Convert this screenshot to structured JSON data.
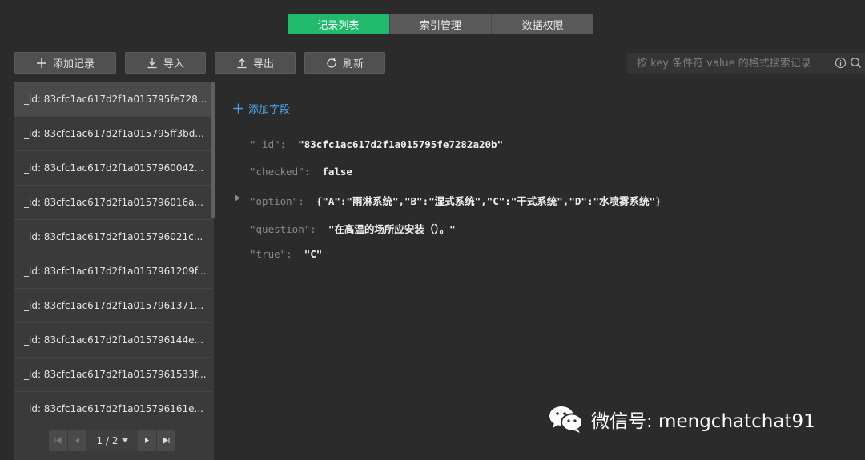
{
  "tabs": [
    "记录列表",
    "索引管理",
    "数据权限"
  ],
  "toolbar": {
    "add_label": "添加记录",
    "import_label": "导入",
    "export_label": "导出",
    "refresh_label": "刷新"
  },
  "search": {
    "placeholder": "按 key 条件符 value 的格式搜索记录"
  },
  "records": [
    "_id: 83cfc1ac617d2f1a015795fe728...",
    "_id: 83cfc1ac617d2f1a015795ff3bd...",
    "_id: 83cfc1ac617d2f1a0157960042...",
    "_id: 83cfc1ac617d2f1a015796016a...",
    "_id: 83cfc1ac617d2f1a015796021c...",
    "_id: 83cfc1ac617d2f1a0157961209f...",
    "_id: 83cfc1ac617d2f1a0157961371...",
    "_id: 83cfc1ac617d2f1a015796144e...",
    "_id: 83cfc1ac617d2f1a0157961533f...",
    "_id: 83cfc1ac617d2f1a015796161e..."
  ],
  "pager": {
    "label": "1 / 2"
  },
  "detail": {
    "add_field_label": "添加字段",
    "fields": [
      {
        "key": "\"_id\":",
        "value": "\"83cfc1ac617d2f1a015795fe7282a20b\""
      },
      {
        "key": "\"checked\":",
        "value": "false"
      },
      {
        "key": "\"option\":",
        "value": "{\"A\":\"雨淋系统\",\"B\":\"湿式系统\",\"C\":\"干式系统\",\"D\":\"水喷雾系统\"}"
      },
      {
        "key": "\"question\":",
        "value": "\"在高温的场所应安装（）。\""
      },
      {
        "key": "\"true\":",
        "value": "\"C\""
      }
    ]
  },
  "watermark": {
    "text": "微信号: mengchatchat91"
  },
  "colors": {
    "accent": "#1fba6b",
    "link": "#4a9ee0",
    "background": "#2b2b2b"
  }
}
